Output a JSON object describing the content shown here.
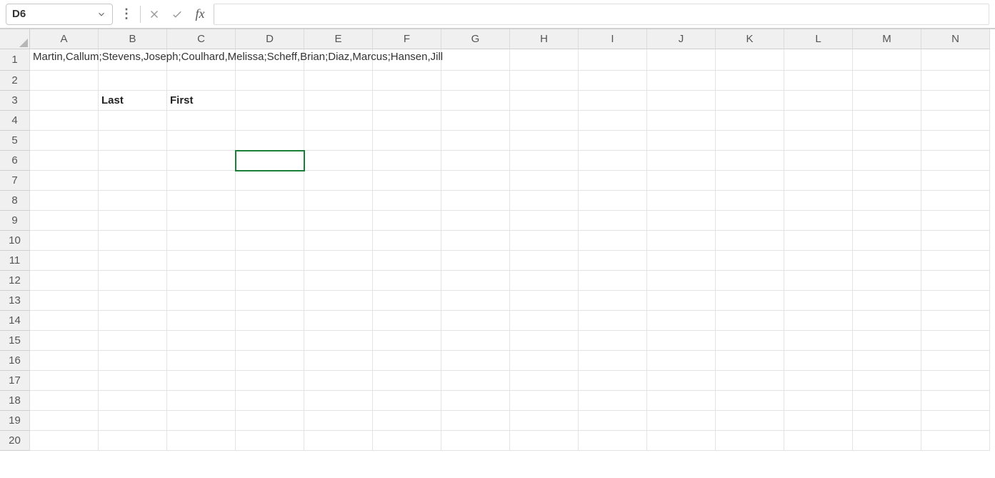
{
  "nameBox": {
    "value": "D6"
  },
  "formulaBar": {
    "value": ""
  },
  "columns": [
    "A",
    "B",
    "C",
    "D",
    "E",
    "F",
    "G",
    "H",
    "I",
    "J",
    "K",
    "L",
    "M",
    "N"
  ],
  "rowCount": 20,
  "activeCell": {
    "row": 6,
    "col": 4
  },
  "cells": {
    "A1": {
      "text": "Martin,Callum;Stevens,Joseph;Coulhard,Melissa;Scheff,Brian;Diaz,Marcus;Hansen,Jill",
      "overflow": true
    },
    "B3": {
      "text": "Last",
      "bold": true
    },
    "C3": {
      "text": "First",
      "bold": true
    }
  },
  "rowHeadersHighlighted": []
}
